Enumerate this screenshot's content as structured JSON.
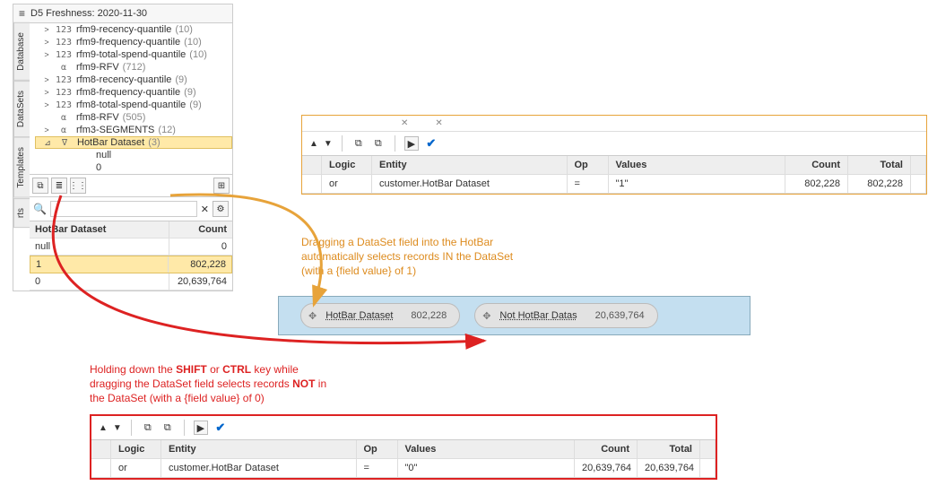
{
  "sidebar": {
    "title": "D5 Freshness: 2020-11-30",
    "tabs": [
      "Database",
      "DataSets",
      "Templates",
      "rts"
    ],
    "tree": [
      {
        "caret": ">",
        "tag": "123",
        "label": "rfm9-recency-quantile",
        "count": "(10)",
        "indent": 0
      },
      {
        "caret": ">",
        "tag": "123",
        "label": "rfm9-frequency-quantile",
        "count": "(10)",
        "indent": 0
      },
      {
        "caret": ">",
        "tag": "123",
        "label": "rfm9-total-spend-quantile",
        "count": "(10)",
        "indent": 0
      },
      {
        "caret": "",
        "tag": "α",
        "label": "rfm9-RFV",
        "count": "(712)",
        "indent": 0
      },
      {
        "caret": ">",
        "tag": "123",
        "label": "rfm8-recency-quantile",
        "count": "(9)",
        "indent": 0
      },
      {
        "caret": ">",
        "tag": "123",
        "label": "rfm8-frequency-quantile",
        "count": "(9)",
        "indent": 0
      },
      {
        "caret": ">",
        "tag": "123",
        "label": "rfm8-total-spend-quantile",
        "count": "(9)",
        "indent": 0
      },
      {
        "caret": "",
        "tag": "α",
        "label": "rfm8-RFV",
        "count": "(505)",
        "indent": 0
      },
      {
        "caret": ">",
        "tag": "α",
        "label": "rfm3-SEGMENTS",
        "count": "(12)",
        "indent": 0
      },
      {
        "caret": "⊿",
        "tag": "∇",
        "label": "HotBar Dataset",
        "count": "(3)",
        "indent": 0,
        "selected": true
      },
      {
        "caret": "",
        "tag": "",
        "label": "null",
        "count": "",
        "indent": 1
      },
      {
        "caret": "",
        "tag": "",
        "label": "0",
        "count": "",
        "indent": 1
      }
    ],
    "search_placeholder": ""
  },
  "grid": {
    "headers": [
      "HotBar Dataset",
      "Count"
    ],
    "rows": [
      {
        "c1": "null",
        "c2": "0"
      },
      {
        "c1": "1",
        "c2": "802,228",
        "selected": true
      },
      {
        "c1": "0",
        "c2": "20,639,764"
      }
    ]
  },
  "query_orange": {
    "headers": {
      "logic": "Logic",
      "entity": "Entity",
      "op": "Op",
      "values": "Values",
      "count": "Count",
      "total": "Total"
    },
    "row": {
      "logic": "or",
      "entity": "customer.HotBar Dataset",
      "op": "=",
      "values": "\"1\"",
      "count": "802,228",
      "total": "802,228"
    }
  },
  "query_red": {
    "headers": {
      "logic": "Logic",
      "entity": "Entity",
      "op": "Op",
      "values": "Values",
      "count": "Count",
      "total": "Total"
    },
    "row": {
      "logic": "or",
      "entity": "customer.HotBar Dataset",
      "op": "=",
      "values": "\"0\"",
      "count": "20,639,764",
      "total": "20,639,764"
    }
  },
  "hotbar": {
    "chip1_label": "HotBar Dataset",
    "chip1_count": "802,228",
    "chip2_label": "Not HotBar Datas",
    "chip2_count": "20,639,764"
  },
  "annotation1": {
    "l1": "Dragging a DataSet field into the HotBar",
    "l2": "automatically selects records IN the DataSet",
    "l3": "(with a {field value} of 1)"
  },
  "annotation2": {
    "part1": "Holding down the ",
    "shift": "SHIFT",
    "part2": " or ",
    "ctrl": "CTRL",
    "part3": " key while",
    "l2a": "dragging the DataSet field selects records ",
    "not": "NOT",
    "l2b": " in",
    "l3": "the DataSet (with a {field value} of 0)"
  }
}
